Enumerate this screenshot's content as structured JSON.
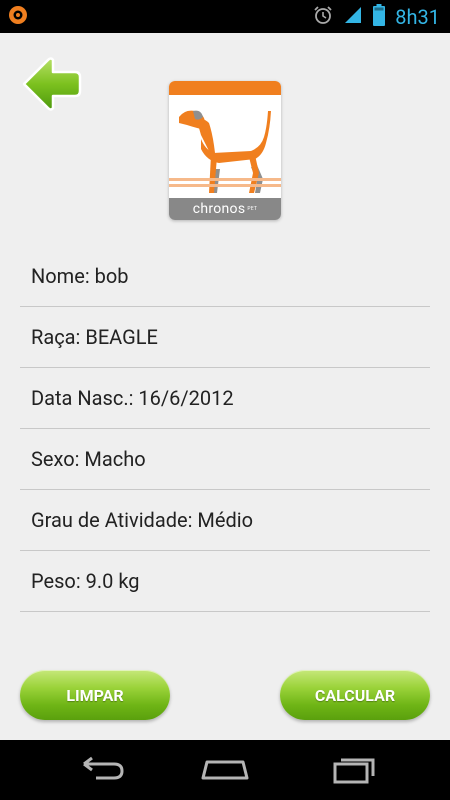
{
  "status_bar": {
    "time": "8h31",
    "left_icon": "app-notification-icon",
    "right_icons": [
      "alarm-icon",
      "signal-icon",
      "battery-icon"
    ]
  },
  "header": {
    "back_icon": "back-arrow-icon",
    "logo_text": "chronos",
    "logo_subtext": "PET"
  },
  "fields": [
    {
      "label": "Nome: bob"
    },
    {
      "label": "Raça: BEAGLE"
    },
    {
      "label": "Data Nasc.: 16/6/2012"
    },
    {
      "label": "Sexo: Macho"
    },
    {
      "label": "Grau de Atividade: Médio"
    },
    {
      "label": "Peso: 9.0 kg"
    }
  ],
  "buttons": {
    "limpar": "LIMPAR",
    "calcular": "CALCULAR"
  },
  "nav_bar": {
    "icons": [
      "back-nav-icon",
      "home-nav-icon",
      "recent-apps-icon"
    ]
  },
  "colors": {
    "accent_green": "#7cc11f",
    "brand_orange": "#f07f1f",
    "status_blue": "#33b5e5"
  }
}
